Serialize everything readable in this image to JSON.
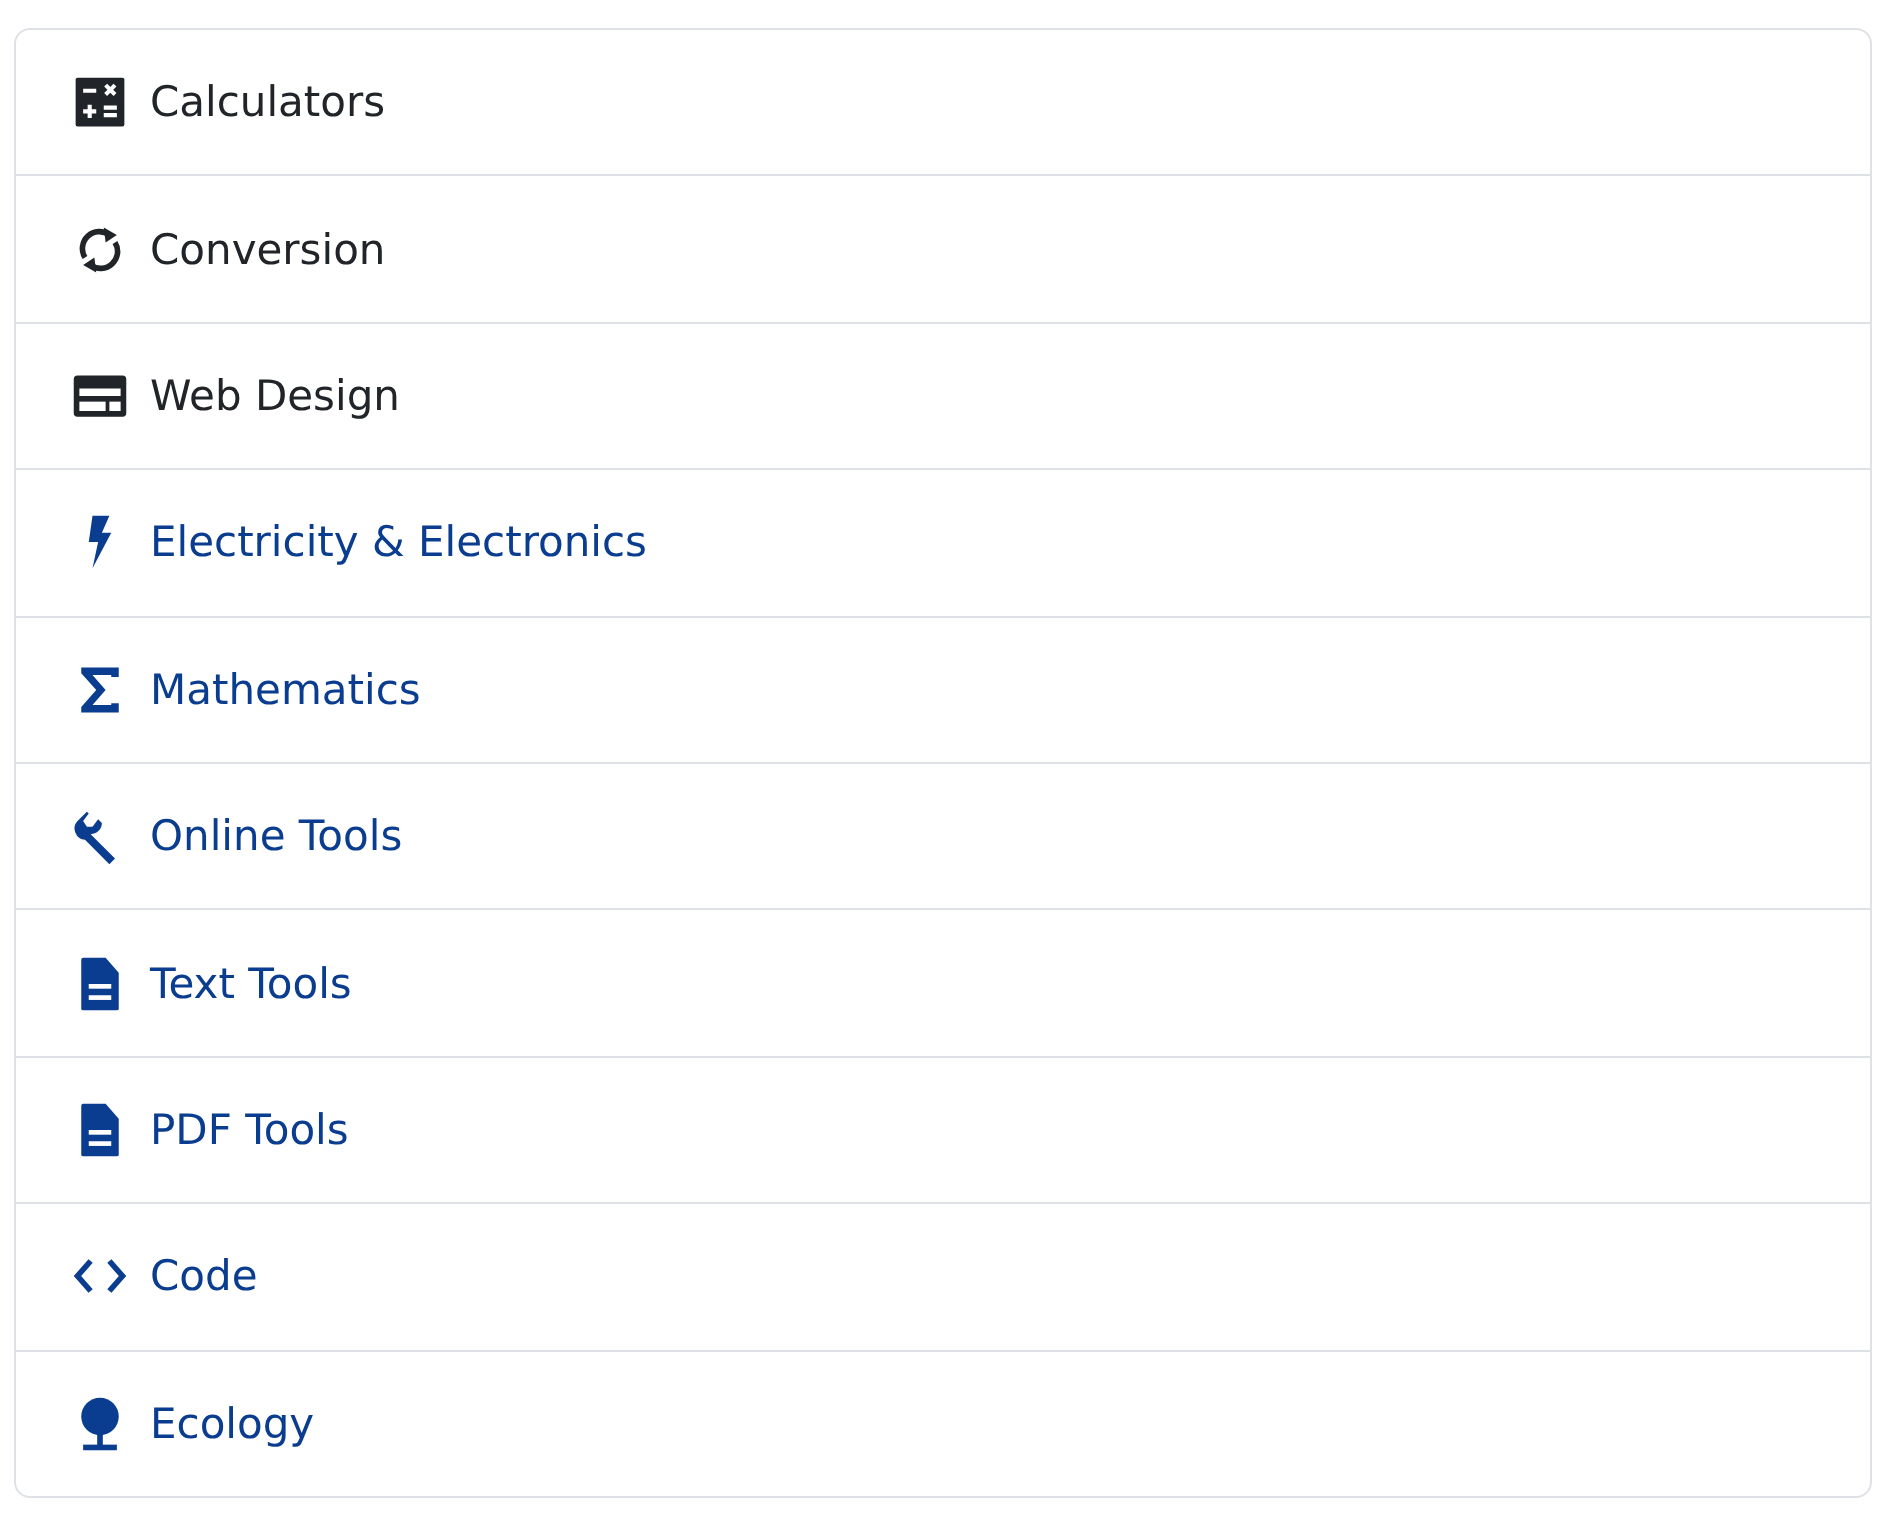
{
  "items": [
    {
      "label": "Calculators",
      "kind": "category"
    },
    {
      "label": "Conversion",
      "kind": "category"
    },
    {
      "label": "Web Design",
      "kind": "category"
    },
    {
      "label": "Electricity & Electronics",
      "kind": "link"
    },
    {
      "label": "Mathematics",
      "kind": "link"
    },
    {
      "label": "Online Tools",
      "kind": "link"
    },
    {
      "label": "Text Tools",
      "kind": "link"
    },
    {
      "label": "PDF Tools",
      "kind": "link"
    },
    {
      "label": "Code",
      "kind": "link"
    },
    {
      "label": "Ecology",
      "kind": "link"
    }
  ]
}
